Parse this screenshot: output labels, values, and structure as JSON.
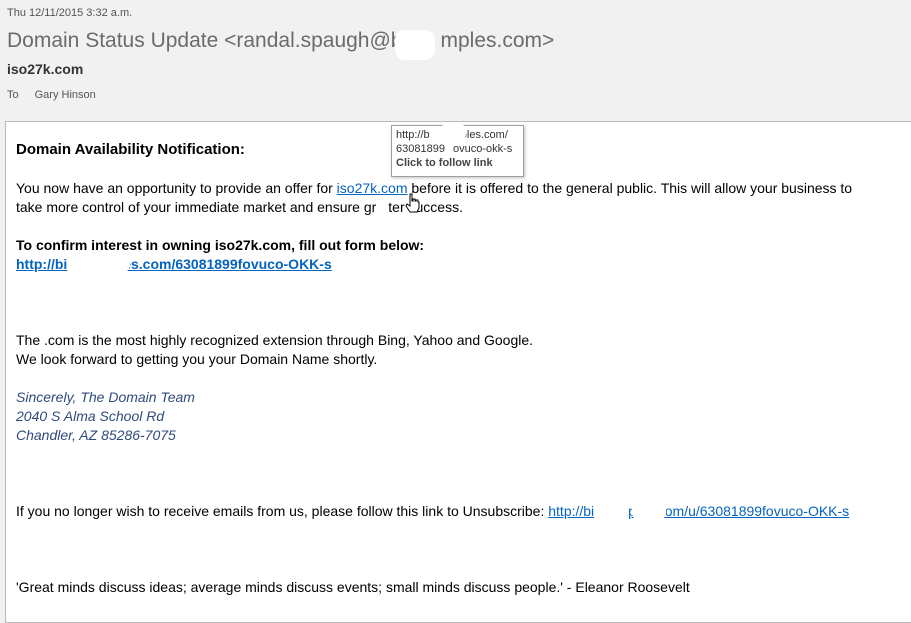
{
  "header": {
    "date": "Thu 12/11/2015 3:32 a.m.",
    "subject": "Domain Status Update <randal.spaugh@b",
    "subject_tail": "mples.com>",
    "from": "iso27k.com",
    "to_label": "To",
    "to_name": "Gary Hinson"
  },
  "tooltip": {
    "line1": "http://b",
    "line1_tail": "mples.com/",
    "line2": "63081899",
    "line2_tail": "ovuco-okk-s",
    "line3": "Click to follow link"
  },
  "email": {
    "heading": "Domain Availability Notification:",
    "para1_a": "You now have an opportunity to provide an offer for ",
    "para1_link": "iso27k.com",
    "para1_b": " before it is offered to the general public. This will allow your business to",
    "para1_line2_a": "take more control of your immediate market and ensure gr",
    "para1_line2_b": "ter success.",
    "confirm": "To confirm interest in owning iso27k.com, fill out form below:",
    "confirm_link_a": "http://bi",
    "confirm_link_b": "les.com/63081899fovuco-OKK-s",
    "para2_line1": "The .com is the most highly recognized extension through Bing, Yahoo and Google.",
    "para2_line2": "We look forward to getting you your Domain Name shortly.",
    "sig1": "Sincerely, The Domain Team",
    "sig2": "2040 S Alma School Rd",
    "sig3": "Chandler, AZ 85286-7075",
    "unsub_text": "If you no longer wish to receive emails from us, please follow this link to Unsubscribe: ",
    "unsub_link_a": "http://bi",
    "unsub_link_b": "ples.com/u/63081899fovuco-OKK-s",
    "quote": "'Great minds discuss ideas; average minds discuss events; small minds discuss people.' - Eleanor Roosevelt"
  }
}
